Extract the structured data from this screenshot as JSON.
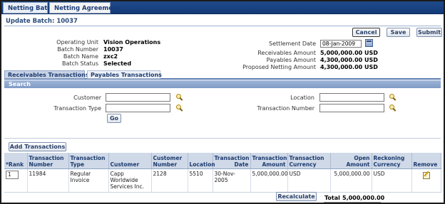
{
  "tabs": [
    "Netting Batch",
    "Netting Agreement"
  ],
  "page_title": "Update Batch: 10037",
  "buttons": {
    "cancel": "Cancel",
    "save": "Save",
    "submit": "Submit",
    "go": "Go",
    "add_transactions": "Add Transactions",
    "recalculate": "Recalculate"
  },
  "batch": {
    "operating_unit_label": "Operating Unit",
    "operating_unit": "Vision Operations",
    "batch_number_label": "Batch Number",
    "batch_number": "10037",
    "batch_name_label": "Batch Name",
    "batch_name": "zxc2",
    "batch_status_label": "Batch Status",
    "batch_status": "Selected"
  },
  "amounts": {
    "settlement_date_label": "Settlement Date",
    "settlement_date": "08-Jan-2009",
    "receivables_label": "Receivables Amount",
    "receivables": "5,000,000.00 USD",
    "payables_label": "Payables Amount",
    "payables": "4,300,000.00 USD",
    "proposed_label": "Proposed Netting Amount",
    "proposed": "4,300,000.00 USD"
  },
  "subtabs": [
    "Receivables Transactions",
    "Payables Transactions"
  ],
  "search": {
    "title": "Search",
    "customer_label": "Customer",
    "transaction_type_label": "Transaction Type",
    "location_label": "Location",
    "transaction_number_label": "Transaction Number"
  },
  "table": {
    "headers": [
      "*Rank",
      "Transaction Number",
      "Transaction Type",
      "Customer",
      "Customer Number",
      "Location",
      "Transaction Date",
      "Transaction Amount",
      "Transaction Currency",
      "Open Amount",
      "Reckoning Currency",
      "Remove"
    ],
    "rows": [
      {
        "rank": "1",
        "transaction_number": "11984",
        "transaction_type": "Regular Invoice",
        "customer": "Capp Worldwide Services Inc.",
        "customer_number": "2128",
        "location": "5510",
        "transaction_date": "30-Nov-2005",
        "transaction_amount": "5,000,000.00",
        "transaction_currency": "USD",
        "open_amount": "5,000,000.00",
        "reckoning_currency": "USD"
      }
    ]
  },
  "total_label": "Total",
  "total": "5,000,000.00"
}
